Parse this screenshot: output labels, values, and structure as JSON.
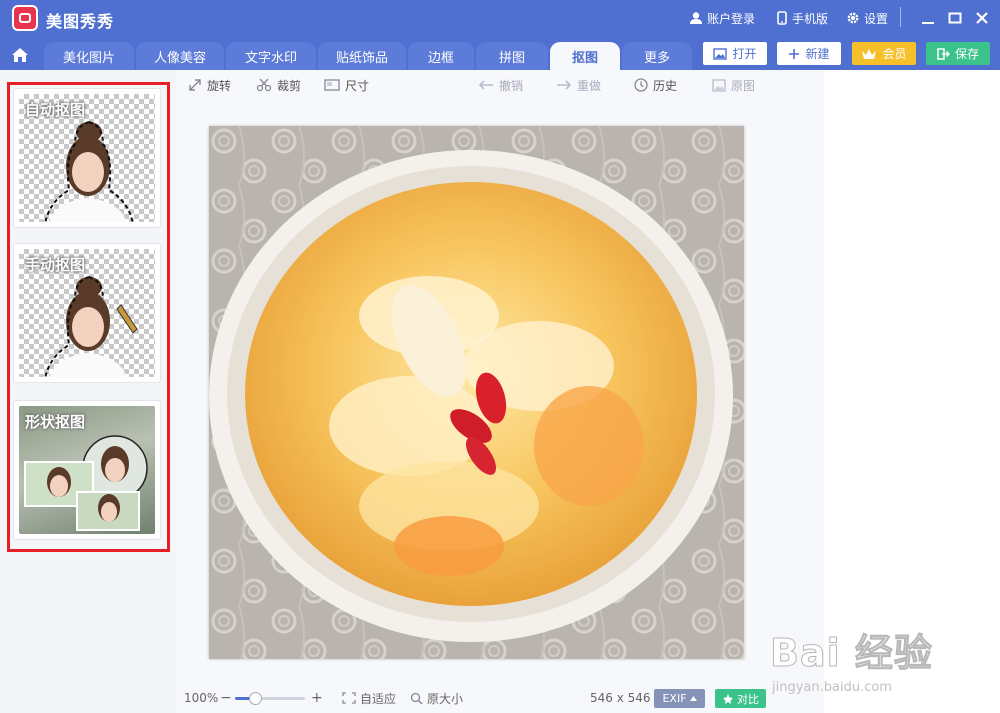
{
  "app": {
    "title": "美图秀秀"
  },
  "titlebar": {
    "account_label": "账户登录",
    "mobile_label": "手机版",
    "settings_label": "设置"
  },
  "tabs": [
    {
      "label": "美化图片",
      "active": false
    },
    {
      "label": "人像美容",
      "active": false
    },
    {
      "label": "文字水印",
      "active": false
    },
    {
      "label": "贴纸饰品",
      "active": false
    },
    {
      "label": "边框",
      "active": false
    },
    {
      "label": "拼图",
      "active": false
    },
    {
      "label": "抠图",
      "active": true
    },
    {
      "label": "更多",
      "active": false
    }
  ],
  "actions": {
    "open": "打开",
    "new": "新建",
    "vip": "会员",
    "save": "保存"
  },
  "toolbar": {
    "rotate": "旋转",
    "crop": "裁剪",
    "size": "尺寸",
    "undo": "撤销",
    "redo": "重做",
    "history": "历史",
    "original": "原图"
  },
  "cutout_modes": [
    {
      "label": "自动抠图"
    },
    {
      "label": "手动抠图"
    },
    {
      "label": "形状抠图"
    }
  ],
  "bottombar": {
    "zoom": "100%",
    "zoom_level": 0.28,
    "fit": "自适应",
    "actual_size": "原大小",
    "dimensions": "546 x 546",
    "exif": "EXIF",
    "compare": "对比"
  },
  "watermark": {
    "main": "Bai 经验",
    "sub": "jingyan.baidu.com"
  },
  "colors": {
    "primary": "#4f6fd1",
    "vip": "#f6c02b",
    "save": "#3cc38c",
    "highlight": "#e61e25"
  }
}
